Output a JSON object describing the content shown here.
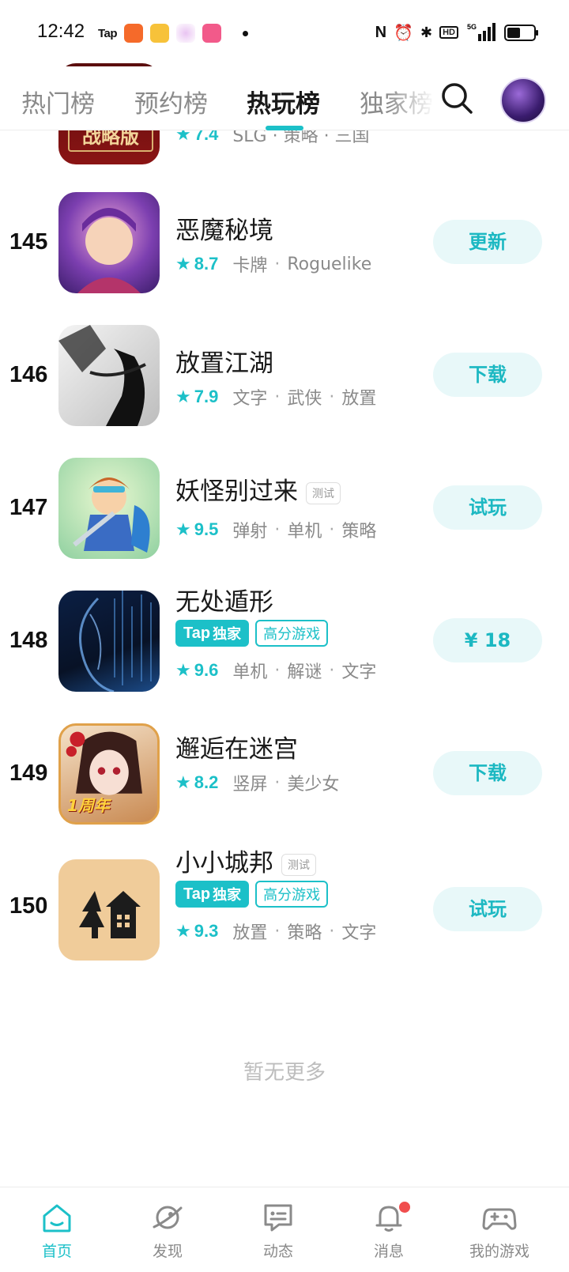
{
  "status_bar": {
    "time": "12:42",
    "tap_app_label": "Tap",
    "network": "5G"
  },
  "tabs": [
    {
      "label": "热门榜",
      "active": false
    },
    {
      "label": "预约榜",
      "active": false
    },
    {
      "label": "热玩榜",
      "active": true
    },
    {
      "label": "独家榜",
      "active": false
    }
  ],
  "list": {
    "partial_row": {
      "rating": "7.4",
      "genres": "SLG · 策略 · 三国",
      "icon_text": "战略版"
    },
    "rows": [
      {
        "rank": "145",
        "title": "恶魔秘境",
        "rating": "8.7",
        "genres": [
          "卡牌",
          "Roguelike"
        ],
        "action": "更新",
        "test_tag": "",
        "exclusive": false
      },
      {
        "rank": "146",
        "title": "放置江湖",
        "rating": "7.9",
        "genres": [
          "文字",
          "武侠",
          "放置"
        ],
        "action": "下载",
        "test_tag": "",
        "exclusive": false
      },
      {
        "rank": "147",
        "title": "妖怪别过来",
        "rating": "9.5",
        "genres": [
          "弹射",
          "单机",
          "策略"
        ],
        "action": "试玩",
        "test_tag": "测试",
        "exclusive": false
      },
      {
        "rank": "148",
        "title": "无处遁形",
        "rating": "9.6",
        "genres": [
          "单机",
          "解谜",
          "文字"
        ],
        "action": "¥ 18",
        "test_tag": "",
        "exclusive": true
      },
      {
        "rank": "149",
        "title": "邂逅在迷宫",
        "rating": "8.2",
        "genres": [
          "竖屏",
          "美少女"
        ],
        "action": "下载",
        "test_tag": "",
        "exclusive": false,
        "icon_text": "1周年"
      },
      {
        "rank": "150",
        "title": "小小城邦",
        "rating": "9.3",
        "genres": [
          "放置",
          "策略",
          "文字"
        ],
        "action": "试玩",
        "test_tag": "测试",
        "exclusive": true
      }
    ],
    "tag_tap": "Tap",
    "tag_exclusive": "独家",
    "tag_high_score": "高分游戏",
    "end_text": "暂无更多"
  },
  "bottom_nav": [
    {
      "label": "首页",
      "icon": "home-icon",
      "active": true
    },
    {
      "label": "发现",
      "icon": "planet-icon",
      "active": false
    },
    {
      "label": "动态",
      "icon": "chat-icon",
      "active": false
    },
    {
      "label": "消息",
      "icon": "bell-icon",
      "active": false,
      "badge": true
    },
    {
      "label": "我的游戏",
      "icon": "gamepad-icon",
      "active": false
    }
  ],
  "colors": {
    "accent": "#1cc0c8",
    "button_bg": "#e8f8f9",
    "badge": "#f04e4e"
  }
}
